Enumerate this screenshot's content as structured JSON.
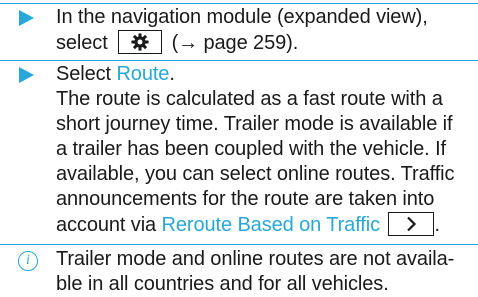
{
  "step1": {
    "line1": "In the navigation module (expanded view),",
    "select_word": "select",
    "page_ref": "(→ page 259)."
  },
  "step2": {
    "select_word": "Select ",
    "route_link": "Route",
    "desc_line1": "The route is calculated as a fast route with a",
    "desc_line2": "short journey time. Trailer mode is available if",
    "desc_line3": "a trailer has been coupled with the vehicle. If",
    "desc_line4": "available, you can select online routes. Traffic",
    "desc_line5": "announcements for the route are taken into",
    "desc_line6_pre": "account via ",
    "reroute_link": "Reroute Based on Traffic",
    "desc_line6_post": "."
  },
  "note": {
    "icon_glyph": "i",
    "line1": "Trailer mode and online routes are not availa-",
    "line2": "ble in all countries and for all vehicles."
  },
  "colors": {
    "accent": "#27a8d8",
    "text": "#1a1a1a"
  },
  "icons": {
    "settings_button": "gear-icon",
    "next_button": "chevron-right-icon",
    "bullet": "arrow-bullet-icon",
    "info": "info-icon"
  }
}
